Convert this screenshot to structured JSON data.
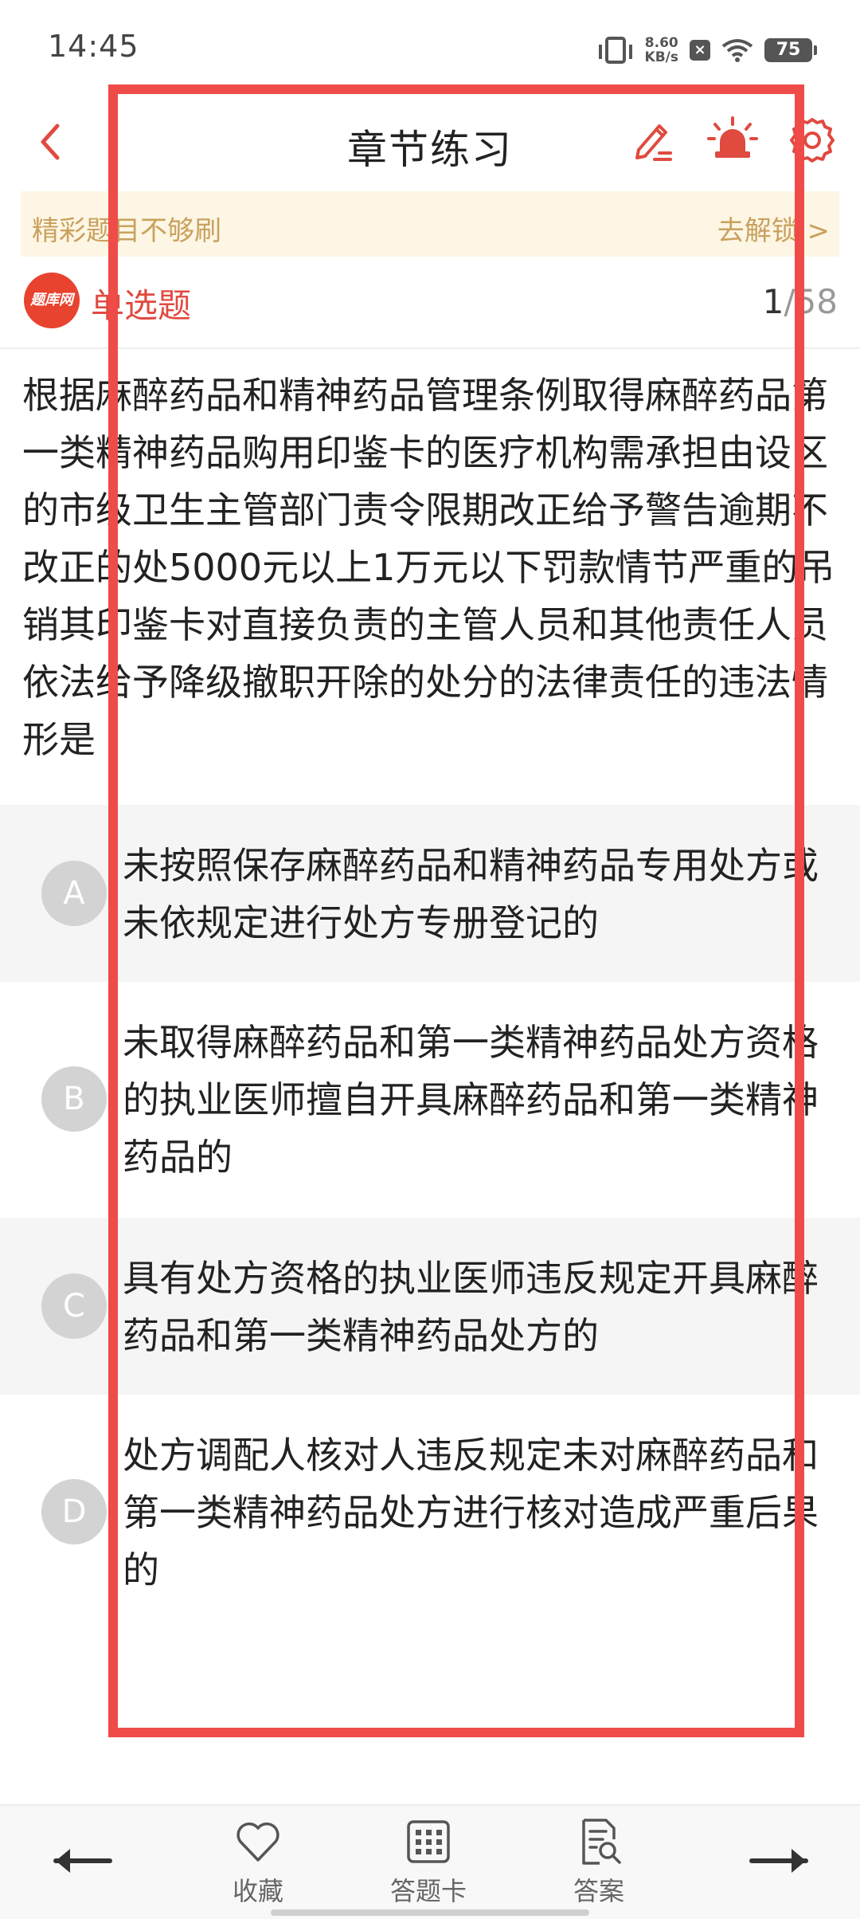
{
  "status_bar": {
    "time": "14:45",
    "net_speed_value": "8.60",
    "net_speed_unit": "KB/s",
    "battery": "75"
  },
  "header": {
    "title": "章节练习"
  },
  "promo": {
    "text": "精彩题目不够刷",
    "link": "去解锁 >"
  },
  "question": {
    "logo_text": "题库网",
    "type": "单选题",
    "current": "1",
    "total": "/58",
    "text": "根据麻醉药品和精神药品管理条例取得麻醉药品第一类精神药品购用印鉴卡的医疗机构需承担由设区的市级卫生主管部门责令限期改正给予警告逾期不改正的处5000元以上1万元以下罚款情节严重的吊销其印鉴卡对直接负责的主管人员和其他责任人员依法给予降级撤职开除的处分的法律责任的违法情形是"
  },
  "options": [
    {
      "letter": "A",
      "text": "未按照保存麻醉药品和精神药品专用处方或未依规定进行处方专册登记的"
    },
    {
      "letter": "B",
      "text": "未取得麻醉药品和第一类精神药品处方资格的执业医师擅自开具麻醉药品和第一类精神药品的"
    },
    {
      "letter": "C",
      "text": "具有处方资格的执业医师违反规定开具麻醉药品和第一类精神药品处方的"
    },
    {
      "letter": "D",
      "text": "处方调配人核对人违反规定未对麻醉药品和第一类精神药品处方进行核对造成严重后果的"
    }
  ],
  "bottom_nav": {
    "favorite": "收藏",
    "answer_card": "答题卡",
    "answer": "答案"
  },
  "colors": {
    "accent_red": "#e04a3f",
    "overlay_red": "#ee4b49",
    "promo_gold": "#c9a15e"
  }
}
